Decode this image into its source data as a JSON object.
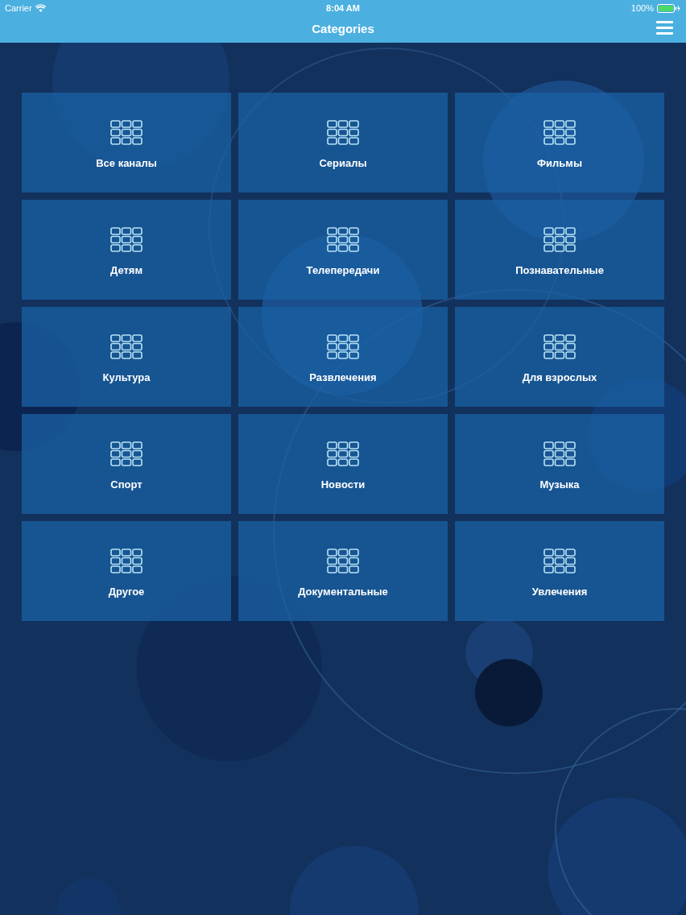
{
  "status_bar": {
    "carrier": "Carrier",
    "time": "8:04 AM",
    "battery": "100%"
  },
  "nav_bar": {
    "title": "Categories"
  },
  "categories": [
    {
      "label": "Все каналы"
    },
    {
      "label": "Сериалы"
    },
    {
      "label": "Фильмы"
    },
    {
      "label": "Детям"
    },
    {
      "label": "Телепередачи"
    },
    {
      "label": "Познавательные"
    },
    {
      "label": "Культура"
    },
    {
      "label": "Развлечения"
    },
    {
      "label": "Для взрослых"
    },
    {
      "label": "Спорт"
    },
    {
      "label": "Новости"
    },
    {
      "label": "Музыка"
    },
    {
      "label": "Другое"
    },
    {
      "label": "Документальные"
    },
    {
      "label": "Увлечения"
    }
  ]
}
